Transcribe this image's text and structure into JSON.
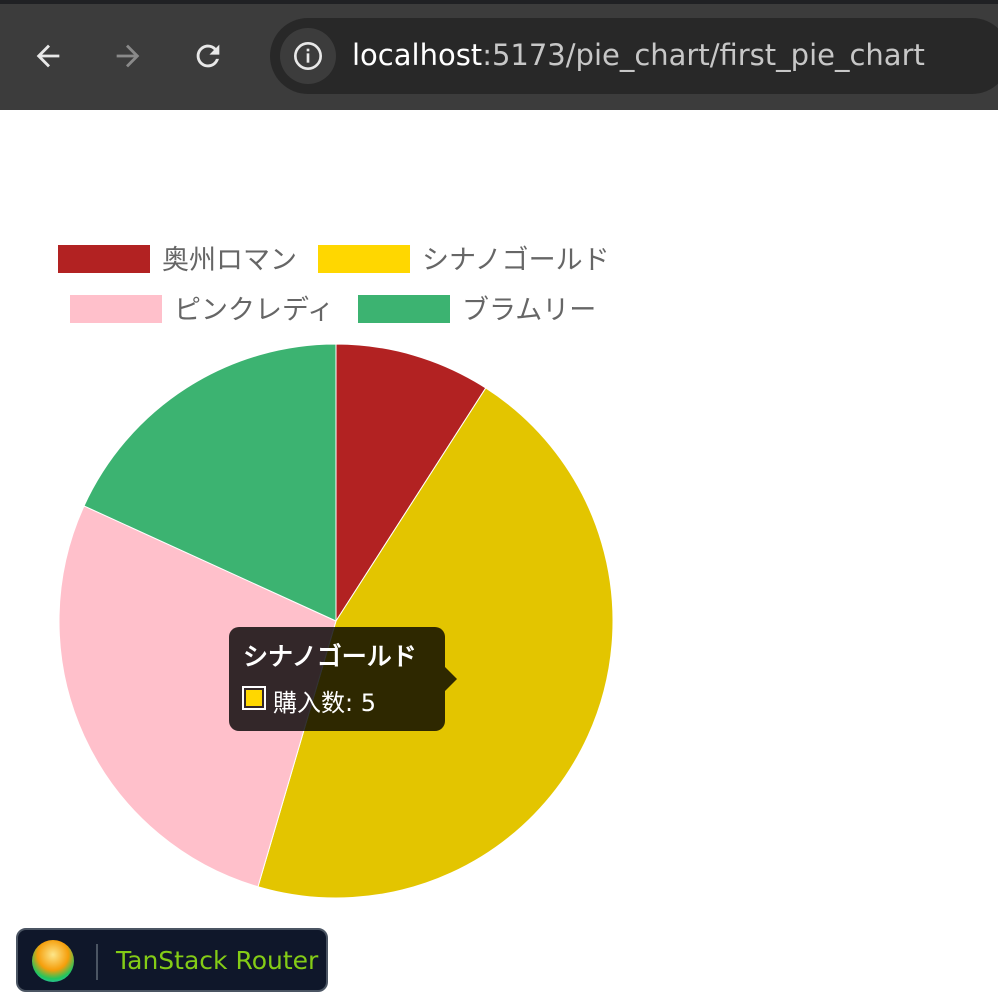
{
  "browser": {
    "url_host": "localhost",
    "url_path": ":5173/pie_chart/first_pie_chart"
  },
  "chart_data": {
    "type": "pie",
    "categories": [
      "奥州ロマン",
      "シナノゴールド",
      "ピンクレディ",
      "ブラムリー"
    ],
    "values": [
      1,
      5,
      3,
      2
    ],
    "colors": [
      "#b22222",
      "#e3c500",
      "#ffc0cb",
      "#3cb371"
    ],
    "legend_colors": [
      "#b22222",
      "#ffd700",
      "#ffc0cb",
      "#3cb371"
    ],
    "legend_position": "top",
    "series_name": "購入数"
  },
  "tooltip": {
    "title": "シナノゴールド",
    "body": "購入数: 5",
    "swatch_color": "#ffd700"
  },
  "router_badge": {
    "label": "TanStack Router"
  }
}
